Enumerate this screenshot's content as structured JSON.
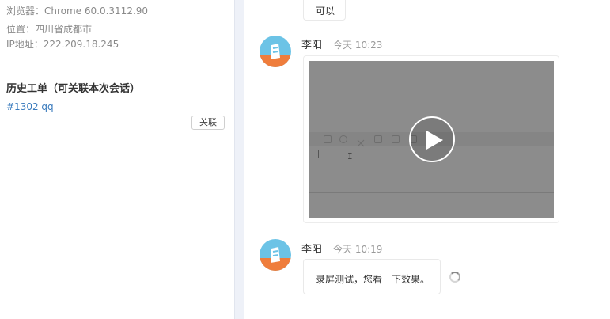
{
  "visitor_info": {
    "browser": "浏览器：Chrome 60.0.3112.90",
    "location": "位置：四川省成都市",
    "ip": "IP地址：222.209.18.245"
  },
  "history": {
    "title": "历史工单（可关联本次会话）",
    "ticket": "#1302 qq",
    "link_button": "关联"
  },
  "messages": [
    {
      "text": "可以"
    },
    {
      "sender": "李阳",
      "time": "今天 10:23",
      "type": "video"
    },
    {
      "sender": "李阳",
      "time": "今天 10:19",
      "text": "录屏测试，您看一下效果。",
      "status": "sending"
    }
  ],
  "colors": {
    "link": "#3a7bbd",
    "avatar_top": "#6cc3e6",
    "avatar_bottom": "#ef7d3c",
    "divider": "#eef1f8"
  }
}
